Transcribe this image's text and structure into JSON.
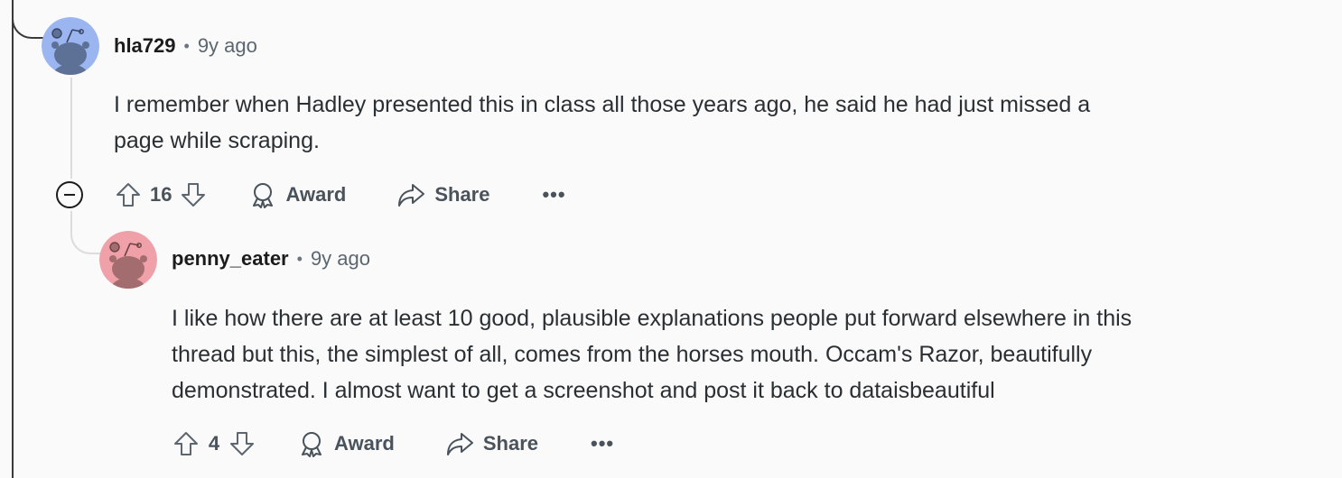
{
  "colors": {
    "background": "#fafafa",
    "avatar_blue": "#9bb5f0",
    "avatar_pink": "#f0a0a8",
    "text_primary": "#1c1c1c",
    "text_secondary": "#5c6670"
  },
  "comments": [
    {
      "username": "hla729",
      "separator": "•",
      "time": "9y ago",
      "avatar_icon": "snoo-avatar-icon",
      "body_lines": [
        "I remember when Hadley presented this in class all those years ago, he said he had just missed a",
        "page while scraping."
      ],
      "score": "16",
      "award_label": "Award",
      "share_label": "Share",
      "more_label": "•••"
    },
    {
      "username": "penny_eater",
      "separator": "•",
      "time": "9y ago",
      "avatar_icon": "snoo-avatar-icon",
      "body_lines": [
        "I like how there are at least 10 good, plausible explanations people put forward elsewhere in this",
        "thread but this, the simplest of all, comes from the horses mouth. Occam's Razor, beautifully",
        "demonstrated. I almost want to get a screenshot and post it back to dataisbeautiful"
      ],
      "score": "4",
      "award_label": "Award",
      "share_label": "Share",
      "more_label": "•••"
    }
  ]
}
